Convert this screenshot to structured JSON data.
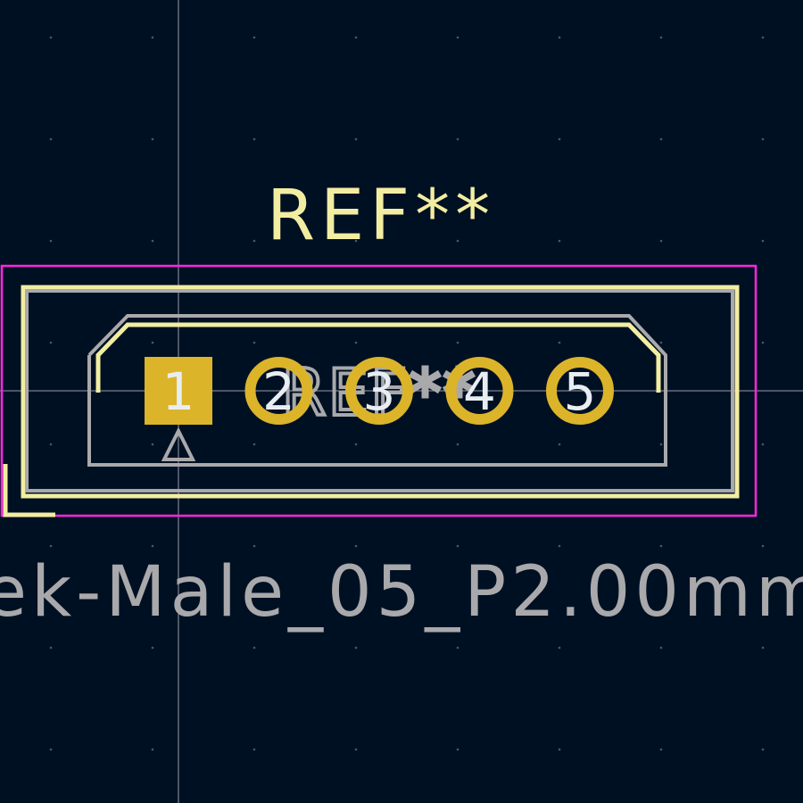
{
  "colors": {
    "background": "#001023",
    "silkscreen": "#f2eda1",
    "fabrication": "#a9a9ab",
    "courtyard": "#ff26e2",
    "pad": "#dbb42a",
    "pad_number": "#e8edf2",
    "crosshair": "#c8ccd4",
    "grid_dot": "#4a5670"
  },
  "footprint": {
    "reference_silk": "REF**",
    "reference_fab": "REF**",
    "value_fab": "ek-Male_05_P2.00mm",
    "pin1_marker": "pin1-triangle-icon"
  },
  "pads": [
    {
      "number": "1",
      "shape": "square"
    },
    {
      "number": "2",
      "shape": "round"
    },
    {
      "number": "3",
      "shape": "round"
    },
    {
      "number": "4",
      "shape": "round"
    },
    {
      "number": "5",
      "shape": "round"
    }
  ]
}
